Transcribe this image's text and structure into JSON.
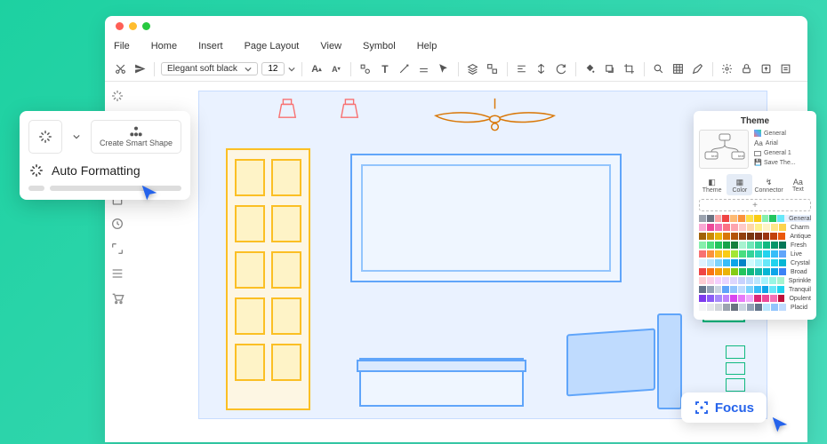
{
  "menu": {
    "items": [
      "File",
      "Home",
      "Insert",
      "Page Layout",
      "View",
      "Symbol",
      "Help"
    ]
  },
  "toolbar": {
    "font": "Elegant soft black",
    "size": "12"
  },
  "popover": {
    "smart_label": "Create Smart Shape",
    "auto_label": "Auto Formatting"
  },
  "theme": {
    "title": "Theme",
    "info": [
      "General",
      "Arial",
      "General 1",
      "Save The..."
    ],
    "tabs": [
      "Theme",
      "Color",
      "Connector",
      "Text"
    ],
    "palettes": [
      {
        "name": "General",
        "colors": [
          "#9ca3af",
          "#6b7280",
          "#fca5a5",
          "#ef4444",
          "#fdba74",
          "#fb923c",
          "#fde047",
          "#facc15",
          "#86efac",
          "#22c55e",
          "#67e8f9",
          "#3b82f6",
          "#c4b5fd",
          "#8b5cf6"
        ],
        "selected": true
      },
      {
        "name": "Charm",
        "colors": [
          "#f9a8d4",
          "#ec4899",
          "#f472b6",
          "#fb7185",
          "#fda4af",
          "#fecaca",
          "#fed7aa",
          "#fef08a",
          "#fef3c7",
          "#fde68a",
          "#fcd34d",
          "#fbbf24",
          "#f59e0b",
          "#d97706"
        ]
      },
      {
        "name": "Antique",
        "colors": [
          "#a16207",
          "#ca8a04",
          "#eab308",
          "#d97706",
          "#b45309",
          "#92400e",
          "#78350f",
          "#7c2d12",
          "#9a3412",
          "#c2410c",
          "#ea580c",
          "#f97316",
          "#fb923c",
          "#fdba74"
        ]
      },
      {
        "name": "Fresh",
        "colors": [
          "#86efac",
          "#4ade80",
          "#22c55e",
          "#16a34a",
          "#15803d",
          "#a7f3d0",
          "#6ee7b7",
          "#34d399",
          "#10b981",
          "#059669",
          "#047857",
          "#065f46",
          "#bbf7d0",
          "#dcfce7"
        ]
      },
      {
        "name": "Live",
        "colors": [
          "#f87171",
          "#fb923c",
          "#fbbf24",
          "#facc15",
          "#a3e635",
          "#4ade80",
          "#34d399",
          "#2dd4bf",
          "#22d3ee",
          "#38bdf8",
          "#60a5fa",
          "#818cf8",
          "#a78bfa",
          "#c084fc"
        ]
      },
      {
        "name": "Crystal",
        "colors": [
          "#e0f2fe",
          "#bae6fd",
          "#7dd3fc",
          "#38bdf8",
          "#0ea5e9",
          "#0284c7",
          "#cffafe",
          "#a5f3fc",
          "#67e8f9",
          "#22d3ee",
          "#06b6d4",
          "#0891b2",
          "#ccfbf1",
          "#99f6e4"
        ]
      },
      {
        "name": "Broad",
        "colors": [
          "#ef4444",
          "#f97316",
          "#f59e0b",
          "#eab308",
          "#84cc16",
          "#22c55e",
          "#10b981",
          "#14b8a6",
          "#06b6d4",
          "#0ea5e9",
          "#3b82f6",
          "#6366f1",
          "#8b5cf6",
          "#a855f7"
        ]
      },
      {
        "name": "Sprinkle",
        "colors": [
          "#fecdd3",
          "#fbcfe8",
          "#f5d0fe",
          "#e9d5ff",
          "#ddd6fe",
          "#c7d2fe",
          "#bfdbfe",
          "#bae6fd",
          "#a5f3fc",
          "#99f6e4",
          "#a7f3d0",
          "#bbf7d0",
          "#d9f99d",
          "#fef08a"
        ]
      },
      {
        "name": "Tranquil",
        "colors": [
          "#64748b",
          "#94a3b8",
          "#cbd5e1",
          "#60a5fa",
          "#93c5fd",
          "#bfdbfe",
          "#7dd3fc",
          "#38bdf8",
          "#0ea5e9",
          "#67e8f9",
          "#22d3ee",
          "#a5b4fc",
          "#818cf8",
          "#6366f1"
        ]
      },
      {
        "name": "Opulent",
        "colors": [
          "#7c3aed",
          "#8b5cf6",
          "#a78bfa",
          "#c084fc",
          "#d946ef",
          "#e879f9",
          "#f0abfc",
          "#db2777",
          "#ec4899",
          "#f472b6",
          "#be123c",
          "#e11d48",
          "#f43f5e",
          "#fb7185"
        ]
      },
      {
        "name": "Placid",
        "colors": [
          "#f3f4f6",
          "#e5e7eb",
          "#d1d5db",
          "#9ca3af",
          "#6b7280",
          "#cbd5e1",
          "#94a3b8",
          "#64748b",
          "#bae6fd",
          "#93c5fd",
          "#bfdbfe",
          "#ddd6fe",
          "#e9d5ff",
          "#fae8ff"
        ]
      }
    ]
  },
  "focus": {
    "label": "Focus"
  }
}
